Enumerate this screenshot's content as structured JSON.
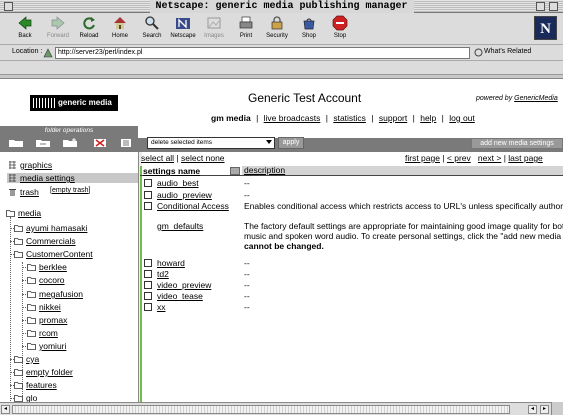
{
  "window": {
    "title": "Netscape: generic media publishing manager"
  },
  "toolbar": {
    "buttons": [
      {
        "label": "Back",
        "icon": "back-arrow-icon"
      },
      {
        "label": "Forward",
        "icon": "forward-arrow-icon",
        "disabled": true
      },
      {
        "label": "Reload",
        "icon": "reload-icon"
      },
      {
        "label": "Home",
        "icon": "home-icon"
      },
      {
        "label": "Search",
        "icon": "search-icon"
      },
      {
        "label": "Netscape",
        "icon": "netscape-icon"
      },
      {
        "label": "Images",
        "icon": "images-icon",
        "disabled": true
      },
      {
        "label": "Print",
        "icon": "print-icon"
      },
      {
        "label": "Security",
        "icon": "lock-icon"
      },
      {
        "label": "Shop",
        "icon": "shop-icon"
      },
      {
        "label": "Stop",
        "icon": "stop-icon"
      }
    ],
    "logo_letter": "N"
  },
  "location": {
    "label": "Location :",
    "url": "http://server23/perl/index.pl",
    "related": "What's Related"
  },
  "page": {
    "brand": "generic media",
    "account_title": "Generic Test Account",
    "powered_prefix": "powered by",
    "powered_brand": "GenericMedia",
    "nav": {
      "current": "gm media",
      "links": [
        "live broadcasts",
        "statistics",
        "support",
        "help",
        "log out"
      ]
    },
    "folder_ops_title": "folder operations",
    "actions": {
      "select_value": "delete selected items",
      "apply": "apply",
      "add": "add new media settings"
    },
    "select_all": "select all",
    "select_none": "select none",
    "pager": {
      "first": "first page",
      "prev": "< prev",
      "next": "next >",
      "last": "last page"
    },
    "table": {
      "col_name": "settings name",
      "col_desc": "description",
      "rows_top": [
        {
          "name": "audio_best",
          "desc": "--"
        },
        {
          "name": "audio_preview",
          "desc": "--"
        },
        {
          "name": "Conditional Access",
          "desc": "Enables conditional access which restricts access to URL's unless specifically authorized"
        }
      ],
      "gm_defaults": {
        "name": "gm_defaults",
        "line1": "The factory default settings are appropriate for maintaining good image quality for both hig",
        "line2": "music and spoken word audio. To create personal settings, click the \"add new media setti",
        "line3": "cannot be changed."
      },
      "rows_bottom": [
        {
          "name": "howard",
          "desc": "--"
        },
        {
          "name": "td2",
          "desc": "--"
        },
        {
          "name": "video_preview",
          "desc": "--"
        },
        {
          "name": "video_tease",
          "desc": "--"
        },
        {
          "name": "xx",
          "desc": "--"
        }
      ]
    },
    "tree": {
      "top_items": [
        {
          "label": "graphics",
          "icon": "grid-icon"
        },
        {
          "label": "media settings",
          "icon": "grid-icon",
          "selected": true
        },
        {
          "label": "trash",
          "icon": "trash-icon",
          "extra": "empty trash"
        }
      ],
      "root": "media",
      "children": [
        {
          "label": "ayumi hamasaki",
          "level": 1
        },
        {
          "label": "Commercials",
          "level": 1
        },
        {
          "label": "CustomerContent",
          "level": 1
        },
        {
          "label": "berklee",
          "level": 2
        },
        {
          "label": "cocoro",
          "level": 2
        },
        {
          "label": "megafusion",
          "level": 2
        },
        {
          "label": "nikkei",
          "level": 2
        },
        {
          "label": "promax",
          "level": 2
        },
        {
          "label": "rcom",
          "level": 2
        },
        {
          "label": "yomiuri",
          "level": 2
        },
        {
          "label": "cya",
          "level": 1
        },
        {
          "label": "empty folder",
          "level": 1
        },
        {
          "label": "features",
          "level": 1
        },
        {
          "label": "glo",
          "level": 1
        }
      ]
    }
  }
}
